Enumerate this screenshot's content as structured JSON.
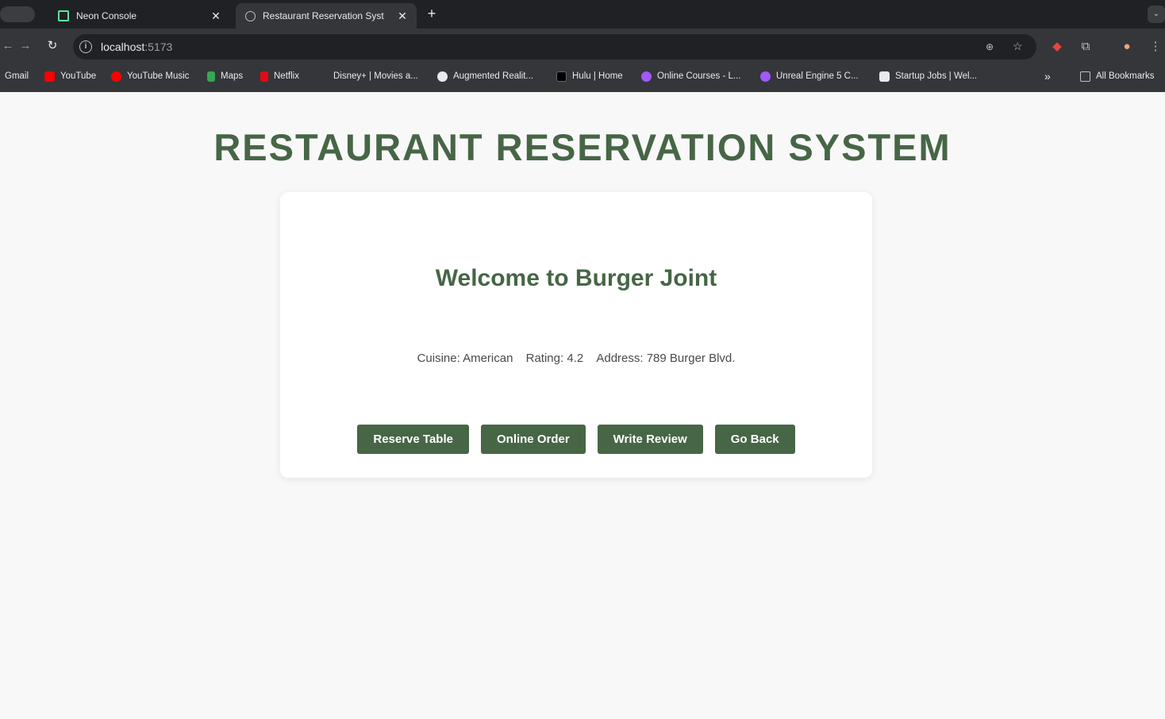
{
  "tabs": [
    {
      "title": "Neon Console",
      "favicon": "neon-icon",
      "active": false
    },
    {
      "title": "Restaurant Reservation Syst",
      "favicon": "globe-icon",
      "active": true
    }
  ],
  "address_bar": {
    "host": "localhost",
    "port": ":5173"
  },
  "bookmarks": [
    {
      "label": "Gmail",
      "icon": "gmail-icon",
      "color": "#d93025"
    },
    {
      "label": "YouTube",
      "icon": "youtube-icon",
      "color": "#ff0000"
    },
    {
      "label": "YouTube Music",
      "icon": "youtube-music-icon",
      "color": "#ff0000"
    },
    {
      "label": "Maps",
      "icon": "maps-icon",
      "color": "#34a853"
    },
    {
      "label": "Netflix",
      "icon": "netflix-icon",
      "color": "#e50914"
    },
    {
      "label": "Disney+ | Movies a...",
      "icon": "disney-icon",
      "color": "#113ccf"
    },
    {
      "label": "Augmented Realit...",
      "icon": "ar-icon",
      "color": "#ffffff"
    },
    {
      "label": "Hulu | Home",
      "icon": "hulu-icon",
      "color": "#000000"
    },
    {
      "label": "Online Courses - L...",
      "icon": "courses-icon",
      "color": "#a259ff"
    },
    {
      "label": "Unreal Engine 5 C...",
      "icon": "unreal-icon",
      "color": "#a259ff"
    },
    {
      "label": "Startup Jobs | Wel...",
      "icon": "startup-jobs-icon",
      "color": "#ffffff"
    }
  ],
  "bookmarks_overflow": "»",
  "all_bookmarks": "All Bookmarks",
  "page": {
    "title": "RESTAURANT RESERVATION SYSTEM",
    "restaurant": {
      "welcome": "Welcome to Burger Joint",
      "cuisine": "Cuisine: American",
      "rating": "Rating: 4.2",
      "address": "Address: 789 Burger Blvd."
    },
    "buttons": {
      "reserve": "Reserve Table",
      "order": "Online Order",
      "review": "Write Review",
      "back": "Go Back"
    }
  },
  "colors": {
    "accent": "#466646",
    "background": "#f8f8f8"
  }
}
